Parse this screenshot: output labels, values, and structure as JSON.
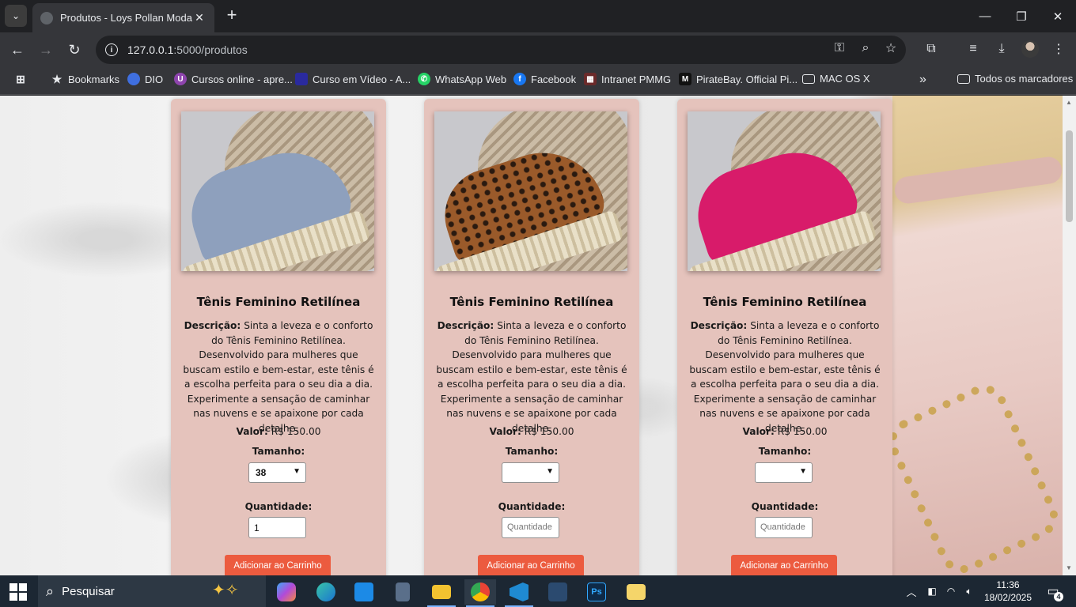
{
  "browser": {
    "tab_title": "Produtos - Loys Pollan Modas",
    "url_host": "127.0.0.1",
    "url_path": ":5000/produtos",
    "bookmarks": [
      {
        "label": "Bookmarks",
        "icon": "star-icon"
      },
      {
        "label": "DIO",
        "icon": "dio-icon"
      },
      {
        "label": "Cursos online - apre...",
        "icon": "course-icon"
      },
      {
        "label": "Curso em Vídeo - A...",
        "icon": "video-icon"
      },
      {
        "label": "WhatsApp Web",
        "icon": "whatsapp-icon"
      },
      {
        "label": "Facebook",
        "icon": "facebook-icon"
      },
      {
        "label": "Intranet PMMG",
        "icon": "intranet-icon"
      },
      {
        "label": "PirateBay. Official Pi...",
        "icon": "piratebay-icon"
      },
      {
        "label": "MAC OS X",
        "icon": "folder-icon"
      }
    ],
    "all_bookmarks": "Todos os marcadores"
  },
  "products": [
    {
      "name": "Tênis Feminino Retilínea",
      "desc_label": "Descrição:",
      "desc_text": "Sinta a leveza e o conforto do Tênis Feminino Retilínea. Desenvolvido para mulheres que buscam estilo e bem-estar, este tênis é a escolha perfeita para o seu dia a dia. Experimente a sensação de caminhar nas nuvens e se apaixone por cada detalhe.",
      "price_label": "Valor:",
      "price": "R$ 150.00",
      "size_label": "Tamanho:",
      "size_value": "38",
      "qty_label": "Quantidade:",
      "qty_value": "1",
      "qty_placeholder": "Quantidade",
      "button": "Adicionar ao Carrinho",
      "color": "#8ea0bd"
    },
    {
      "name": "Tênis Feminino Retilínea",
      "desc_label": "Descrição:",
      "desc_text": "Sinta a leveza e o conforto do Tênis Feminino Retilínea. Desenvolvido para mulheres que buscam estilo e bem-estar, este tênis é a escolha perfeita para o seu dia a dia. Experimente a sensação de caminhar nas nuvens e se apaixone por cada detalhe.",
      "price_label": "Valor:",
      "price": "R$ 150.00",
      "size_label": "Tamanho:",
      "size_value": "",
      "qty_label": "Quantidade:",
      "qty_value": "",
      "qty_placeholder": "Quantidade",
      "button": "Adicionar ao Carrinho",
      "color": "#9a5a2a"
    },
    {
      "name": "Tênis Feminino Retilínea",
      "desc_label": "Descrição:",
      "desc_text": "Sinta a leveza e o conforto do Tênis Feminino Retilínea. Desenvolvido para mulheres que buscam estilo e bem-estar, este tênis é a escolha perfeita para o seu dia a dia. Experimente a sensação de caminhar nas nuvens e se apaixone por cada detalhe.",
      "price_label": "Valor:",
      "price": "R$ 150.00",
      "size_label": "Tamanho:",
      "size_value": "",
      "qty_label": "Quantidade:",
      "qty_value": "",
      "qty_placeholder": "Quantidade",
      "button": "Adicionar ao Carrinho",
      "color": "#d81b6a"
    }
  ],
  "taskbar": {
    "search_placeholder": "Pesquisar",
    "time": "11:36",
    "date": "18/02/2025",
    "notifications": "4"
  },
  "colors": {
    "card_bg": "#e5c3bc",
    "button_bg": "#ec5b3f"
  }
}
